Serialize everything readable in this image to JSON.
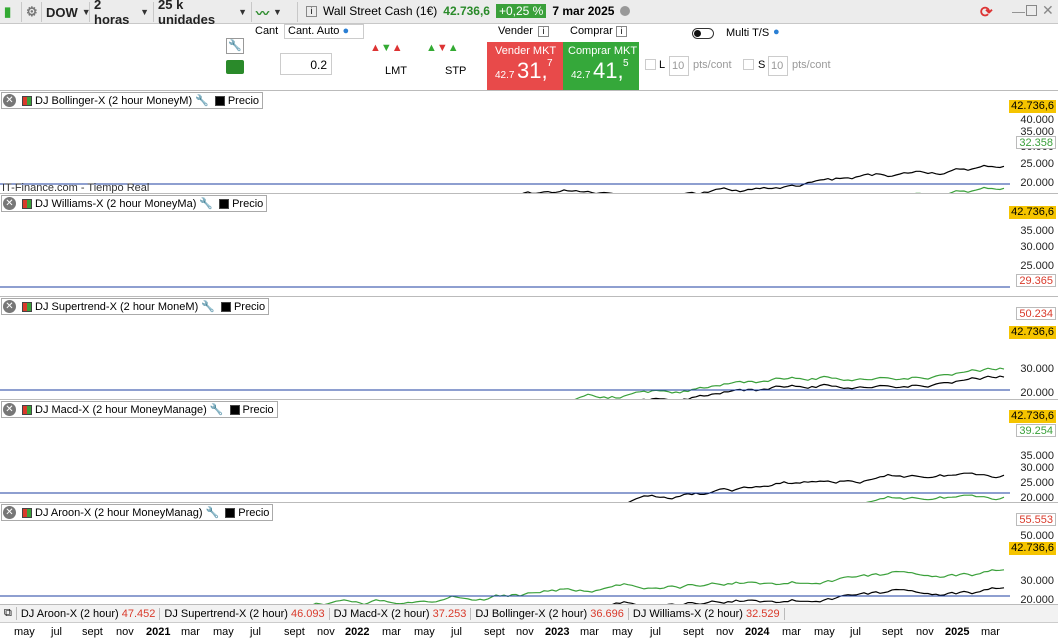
{
  "toolbar": {
    "instrument": "DOW",
    "timeframe": "2 horas",
    "units": "25 k unidades",
    "quote_name": "Wall Street Cash (1€)",
    "quote_price": "42.736,6",
    "quote_change": "+0,25 %",
    "quote_date": "7 mar 2025"
  },
  "trade": {
    "qty_label": "Cant",
    "auto_label": "Cant. Auto",
    "qty_value": "0.2",
    "lmt": "LMT",
    "stp": "STP",
    "sell_header": "Vender",
    "buy_header": "Comprar",
    "sell_label": "Vender MKT",
    "buy_label": "Comprar MKT",
    "sell_prefix": "42.7",
    "sell_big": "31,",
    "sell_sup": "7",
    "buy_prefix": "42.7",
    "buy_big": "41,",
    "buy_sup": "5",
    "multi": "Multi T/S",
    "l_label": "L",
    "s_label": "S",
    "pts": "10",
    "pts_unit": "pts/cont"
  },
  "panels": [
    {
      "title": "DJ Bollinger-X (2 hour MoneyM)",
      "precio": "Precio",
      "price": "42.736,6",
      "ind": "32.358",
      "ticks": [
        "45.000",
        "40.000",
        "35.000",
        "30.000",
        "25.000",
        "20.000"
      ],
      "footer": "IT-Finance.com - Tiempo Real"
    },
    {
      "title": "DJ Williams-X (2 hour MoneyMa)",
      "precio": "Precio",
      "price": "42.736,6",
      "ind": "29.365",
      "ticks": [
        "40.000",
        "35.000",
        "30.000",
        "25.000",
        "20.000"
      ]
    },
    {
      "title": "DJ Supertrend-X (2 hour MoneM)",
      "precio": "Precio",
      "price": "42.736,6",
      "ind": "50.234",
      "ticks": [
        "30.000",
        "20.000"
      ]
    },
    {
      "title": "DJ Macd-X (2 hour MoneyManage)",
      "precio": "Precio",
      "price": "42.736,6",
      "ind": "39.254",
      "ticks": [
        "35.000",
        "30.000",
        "25.000",
        "20.000"
      ]
    },
    {
      "title": "DJ Aroon-X (2 hour MoneyManag)",
      "precio": "Precio",
      "price": "42.736,6",
      "ind": "55.553",
      "ticks": [
        "50.000",
        "30.000",
        "20.000"
      ]
    }
  ],
  "legend": [
    {
      "name": "DJ Aroon-X (2 hour)",
      "value": "47.452"
    },
    {
      "name": "DJ Supertrend-X (2 hour)",
      "value": "46.093"
    },
    {
      "name": "DJ Macd-X (2 hour)",
      "value": "37.253"
    },
    {
      "name": "DJ Bollinger-X (2 hour)",
      "value": "36.696"
    },
    {
      "name": "DJ Williams-X (2 hour)",
      "value": "32.529"
    }
  ],
  "xaxis": [
    "may",
    "jul",
    "sept",
    "nov",
    "2021",
    "mar",
    "may",
    "jul",
    "sept",
    "nov",
    "2022",
    "mar",
    "may",
    "jul",
    "sept",
    "nov",
    "2023",
    "mar",
    "may",
    "jul",
    "sept",
    "nov",
    "2024",
    "mar",
    "may",
    "jul",
    "sept",
    "nov",
    "2025",
    "mar"
  ],
  "colors": {
    "up": "#3aa03a",
    "down": "#d93a2b",
    "price_tag": "#f5c400",
    "accent": "#2a7fd4"
  }
}
